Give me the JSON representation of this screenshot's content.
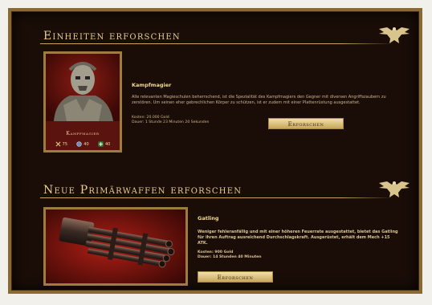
{
  "section_units": {
    "title": "Einheiten erforschen",
    "unit": {
      "card_label": "Kampfmagier",
      "name": "Kampfmagier",
      "description": "Alle relevanten Magieschulen beherrschend, ist die Spezialität des Kampfmagiers den Gegner mit diversen Angriffszaubern zu zerstören. Um seinen eher gebrechlichen Körper zu schützen, ist er zudem mit einer Plattenrüstung ausgestattet.",
      "cost": "Kosten: 20.000 Gold",
      "duration": "Dauer: 1 Stunde 23 Minuten 20 Sekunden",
      "stats": [
        {
          "icon": "sword-icon",
          "value": "75"
        },
        {
          "icon": "shield-icon",
          "value": "40"
        },
        {
          "icon": "health-icon",
          "value": "40"
        }
      ],
      "button": "Erforschen"
    }
  },
  "section_weapons": {
    "title": "Neue Primärwaffen erforschen",
    "weapon": {
      "name": "Gatling",
      "description": "Weniger fehleranfällig und mit einer höheren Feuerrate ausgestattet, bietet das Gatling für ihren Auftrag ausreichend Durchschlagskraft. Ausgerüstet, erhält dem Mech +15 ATK.",
      "cost": "Kosten: 900 Gold",
      "duration": "Dauer: 14 Stunden 40 Minuten",
      "button": "Erforschen"
    }
  },
  "colors": {
    "frame": "#8a6a34",
    "background": "#1a0d07",
    "gold_text": "#e6cf8a",
    "card_red": "#5a130f"
  }
}
